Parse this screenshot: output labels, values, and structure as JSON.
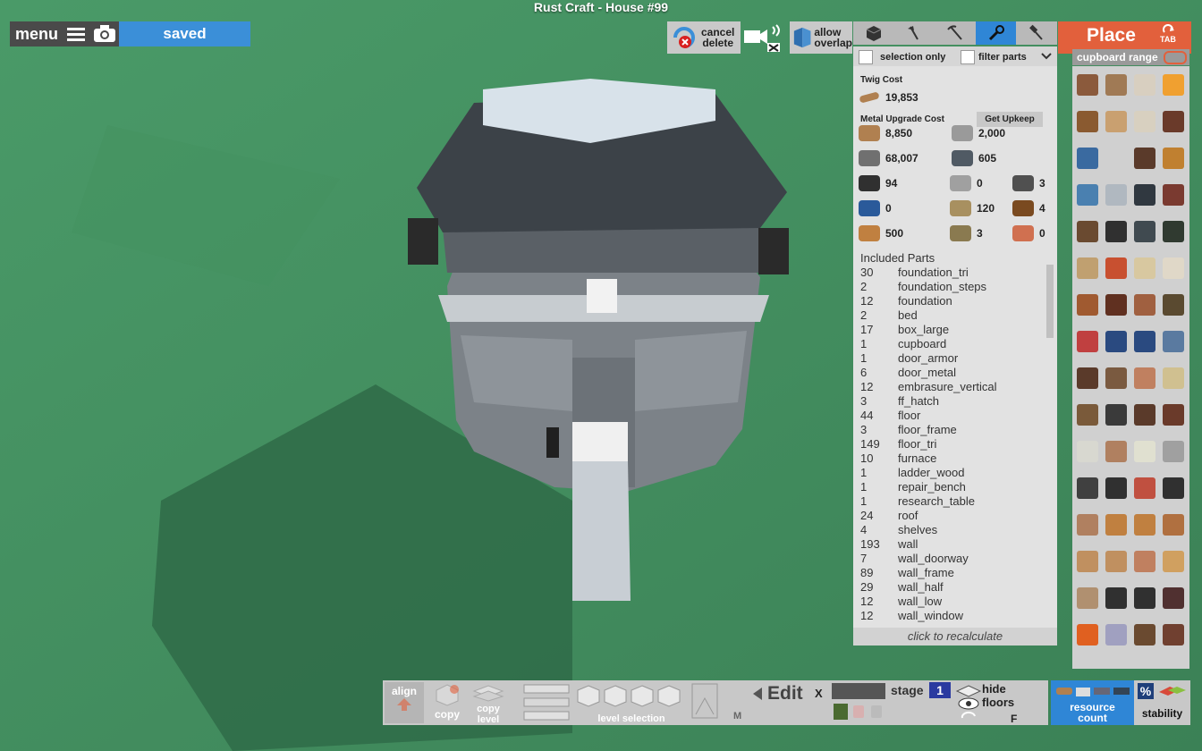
{
  "window_title": "Rust Craft - House #99",
  "topbar": {
    "menu_label": "menu",
    "saved_label": "saved",
    "cancel_delete_label": "cancel\ndelete",
    "allow_overlap_label": "allow\noverlap"
  },
  "tools": {
    "tabs": [
      "cube-icon",
      "hatchet-icon",
      "pickaxe-icon",
      "wrench-icon",
      "hammer-icon"
    ],
    "active_tab": 3,
    "selection_only_label": "selection only",
    "filter_parts_label": "filter parts"
  },
  "place": {
    "label": "Place",
    "tab_hint": "TAB",
    "cupboard_range_label": "cupboard range"
  },
  "costs": {
    "twig_label": "Twig Cost",
    "twig_value": "19,853",
    "metal_label": "Metal Upgrade Cost",
    "get_upkeep_label": "Get Upkeep",
    "resources": [
      {
        "icon": "wood-icon",
        "value": "8,850"
      },
      {
        "icon": "stone-icon",
        "value": "2,000"
      },
      {
        "icon": "metal-fragments-icon",
        "value": "68,007"
      },
      {
        "icon": "hq-metal-icon",
        "value": "605"
      },
      {
        "icon": "gear-part-icon",
        "value": "94"
      },
      {
        "icon": "sheet-metal-icon",
        "value": "0"
      },
      {
        "icon": "pipe-icon",
        "value": "3"
      },
      {
        "icon": "tarp-icon",
        "value": "0"
      },
      {
        "icon": "cloth-icon",
        "value": "120"
      },
      {
        "icon": "log-icon",
        "value": "4"
      },
      {
        "icon": "lowgrade-fuel-icon",
        "value": "500"
      },
      {
        "icon": "rope-icon",
        "value": "3"
      },
      {
        "icon": "leather-icon",
        "value": "0"
      }
    ]
  },
  "included_parts": {
    "title": "Included Parts",
    "items": [
      {
        "qty": "30",
        "name": "foundation_tri"
      },
      {
        "qty": "2",
        "name": "foundation_steps"
      },
      {
        "qty": "12",
        "name": "foundation"
      },
      {
        "qty": "2",
        "name": "bed"
      },
      {
        "qty": "17",
        "name": "box_large"
      },
      {
        "qty": "1",
        "name": "cupboard"
      },
      {
        "qty": "1",
        "name": "door_armor"
      },
      {
        "qty": "6",
        "name": "door_metal"
      },
      {
        "qty": "12",
        "name": "embrasure_vertical"
      },
      {
        "qty": "3",
        "name": "ff_hatch"
      },
      {
        "qty": "44",
        "name": "floor"
      },
      {
        "qty": "3",
        "name": "floor_frame"
      },
      {
        "qty": "149",
        "name": "floor_tri"
      },
      {
        "qty": "10",
        "name": "furnace"
      },
      {
        "qty": "1",
        "name": "ladder_wood"
      },
      {
        "qty": "1",
        "name": "repair_bench"
      },
      {
        "qty": "1",
        "name": "research_table"
      },
      {
        "qty": "24",
        "name": "roof"
      },
      {
        "qty": "4",
        "name": "shelves"
      },
      {
        "qty": "193",
        "name": "wall"
      },
      {
        "qty": "7",
        "name": "wall_doorway"
      },
      {
        "qty": "89",
        "name": "wall_frame"
      },
      {
        "qty": "29",
        "name": "wall_half"
      },
      {
        "qty": "12",
        "name": "wall_low"
      },
      {
        "qty": "12",
        "name": "wall_window"
      }
    ],
    "recalc_label": "click to recalculate"
  },
  "bottom": {
    "align_label": "align",
    "copy_label": "copy",
    "copy_level_label": "copy\nlevel",
    "level_selection_label": "level selection",
    "m_key": "M",
    "edit_label": "Edit",
    "x_key": "X",
    "stage_label": "stage",
    "stage_value": "1",
    "hide_floors_label": "hide\nfloors",
    "f_key": "F",
    "resource_count_label": "resource\ncount",
    "percent_label": "%",
    "stability_label": "stability"
  },
  "inventory_colors": [
    "#8b5a3c",
    "#a07a55",
    "#d8cfc0",
    "#f0a030",
    "#8a5a30",
    "#c9a070",
    "#d8d0c0",
    "#6a3a2a",
    "#3a6aa0",
    "#d0d0d0",
    "#5a3a2a",
    "#c08030",
    "#4a80b0",
    "#b0b8c0",
    "#303840",
    "#7a3a30",
    "#6a4a30",
    "#303030",
    "#404a50",
    "#303a30",
    "#c0a070",
    "#c85030",
    "#d8c8a0",
    "#e0d8c8",
    "#a05a30",
    "#603020",
    "#a06040",
    "#5a4a30",
    "#c04040",
    "#2a4a80",
    "#2a4a80",
    "#5a7aa0",
    "#5a3a2a",
    "#7a5a40",
    "#c08060",
    "#d0c090",
    "#7a5a3a",
    "#3a3a3a",
    "#5a3a2a",
    "#6a3a2a",
    "#d8d8d0",
    "#b08060",
    "#e0e0d0",
    "#a0a0a0",
    "#404040",
    "#303030",
    "#c05040",
    "#303030",
    "#b08060",
    "#c08040",
    "#c08040",
    "#b07040",
    "#c09060",
    "#c09060",
    "#c08060",
    "#d0a060",
    "#b09070",
    "#303030",
    "#303030",
    "#503030",
    "#e06020",
    "#a0a0c0",
    "#6a4a30",
    "#704030"
  ]
}
